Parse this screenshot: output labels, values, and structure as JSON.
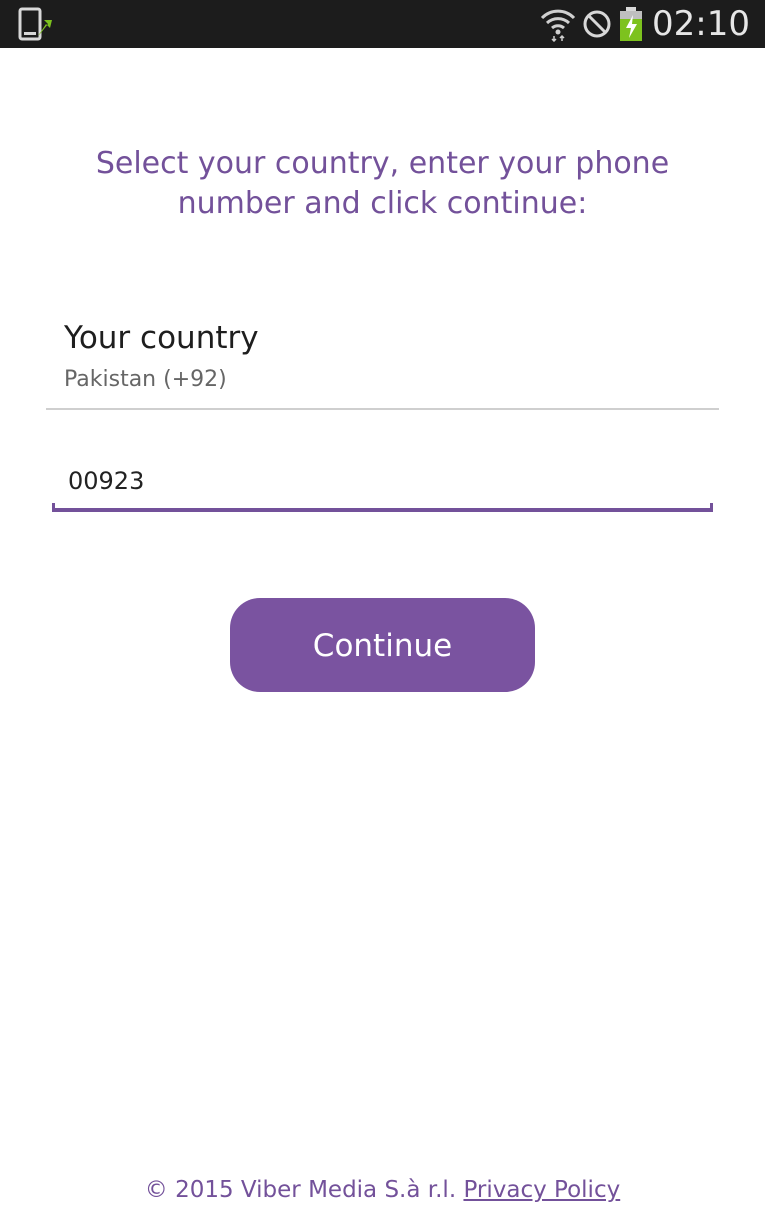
{
  "status_bar": {
    "time": "02:10",
    "icons": [
      "phone-update-icon",
      "wifi-icon",
      "do-not-disturb-icon",
      "battery-charging-icon"
    ],
    "colors": {
      "background": "#1c1c1c",
      "battery_fill": "#7dc21e"
    }
  },
  "instruction": {
    "text": "Select your country, enter your phone number and click continue:"
  },
  "country": {
    "label": "Your country",
    "value": "Pakistan (+92)"
  },
  "phone": {
    "value": "00923"
  },
  "continue_button": {
    "label": "Continue"
  },
  "footer": {
    "copyright": "© 2015 Viber Media S.à r.l.",
    "privacy_link": "Privacy Policy"
  },
  "colors": {
    "accent": "#73519a",
    "button": "#7a53a0",
    "divider": "#cfcfcf"
  }
}
